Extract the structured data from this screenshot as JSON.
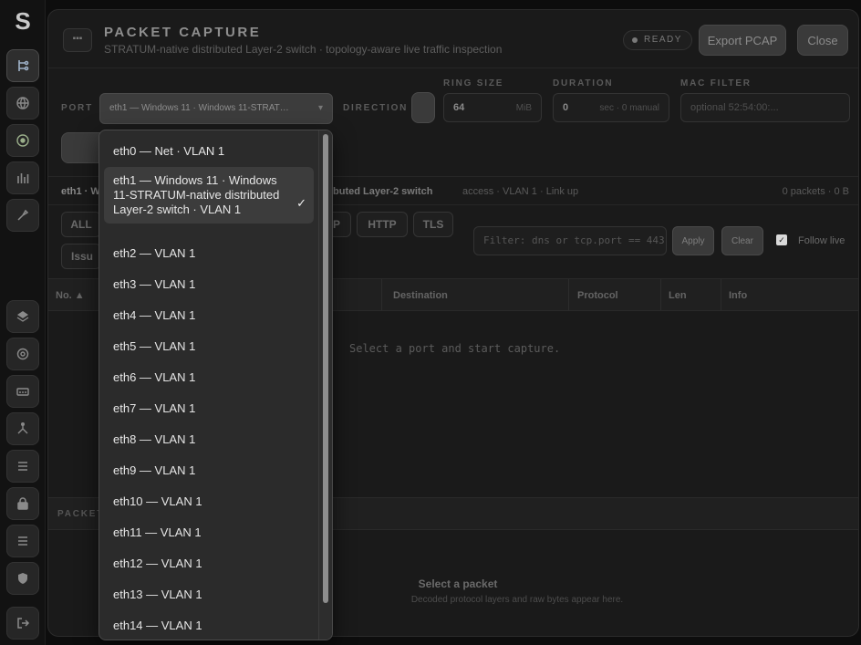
{
  "rail": {
    "top_items": [
      "topology-icon",
      "globe-icon",
      "node-icon",
      "stats-icon",
      "capture-icon"
    ],
    "bottom_items": [
      "layers-icon",
      "target-icon",
      "switch-icon",
      "tree-icon",
      "list-icon",
      "lock-icon",
      "rows-icon",
      "shield-icon",
      "logout-icon"
    ]
  },
  "header": {
    "title": "PACKET CAPTURE",
    "subtitle": "STRATUM-native distributed Layer-2 switch · topology-aware live traffic inspection",
    "status": "READY",
    "export_label": "Export PCAP",
    "close_label": "Close"
  },
  "controls": {
    "port_label": "PORT",
    "port_value": "eth1 — Windows 11 · Windows 11-STRAT…",
    "direction_label": "DIRECTION",
    "ring_size_label": "RING SIZE",
    "ring_size_value": "64",
    "ring_size_unit": "MiB",
    "duration_label": "DURATION",
    "duration_value": "0",
    "duration_unit": "sec · 0 manual",
    "mac_filter_label": "MAC FILTER",
    "mac_filter_placeholder": "optional 52:54:00:..."
  },
  "statusbar": {
    "iface": "eth1 · W",
    "desc": "buted Layer-2 switch",
    "mode": "access · VLAN 1 · Link up",
    "counts": "0 packets · 0 B"
  },
  "filters": {
    "chips": [
      "ALL",
      "P",
      "HTTP",
      "TLS"
    ],
    "issues_chip": "Issu",
    "filter_placeholder": "Filter: dns or tcp.port == 443",
    "apply_label": "Apply",
    "clear_label": "Clear",
    "follow_label": "Follow live"
  },
  "table": {
    "columns": [
      "No. ▲",
      "Destination",
      "Protocol",
      "Len",
      "Info"
    ],
    "empty_message": "Select a port and start capture."
  },
  "details": {
    "bar_label": "PACKET",
    "select_title": "Select a packet",
    "select_subtitle": "Decoded protocol layers and raw bytes appear here."
  },
  "dropdown": {
    "options": [
      "eth0 — Net · VLAN 1",
      "eth1 — Windows 11 · Windows 11-STRATUM-native distributed Layer-2 switch · VLAN 1",
      "eth2 — VLAN 1",
      "eth3 — VLAN 1",
      "eth4 — VLAN 1",
      "eth5 — VLAN 1",
      "eth6 — VLAN 1",
      "eth7 — VLAN 1",
      "eth8 — VLAN 1",
      "eth9 — VLAN 1",
      "eth10 — VLAN 1",
      "eth11 — VLAN 1",
      "eth12 — VLAN 1",
      "eth13 — VLAN 1",
      "eth14 — VLAN 1"
    ],
    "selected_index": 1
  }
}
